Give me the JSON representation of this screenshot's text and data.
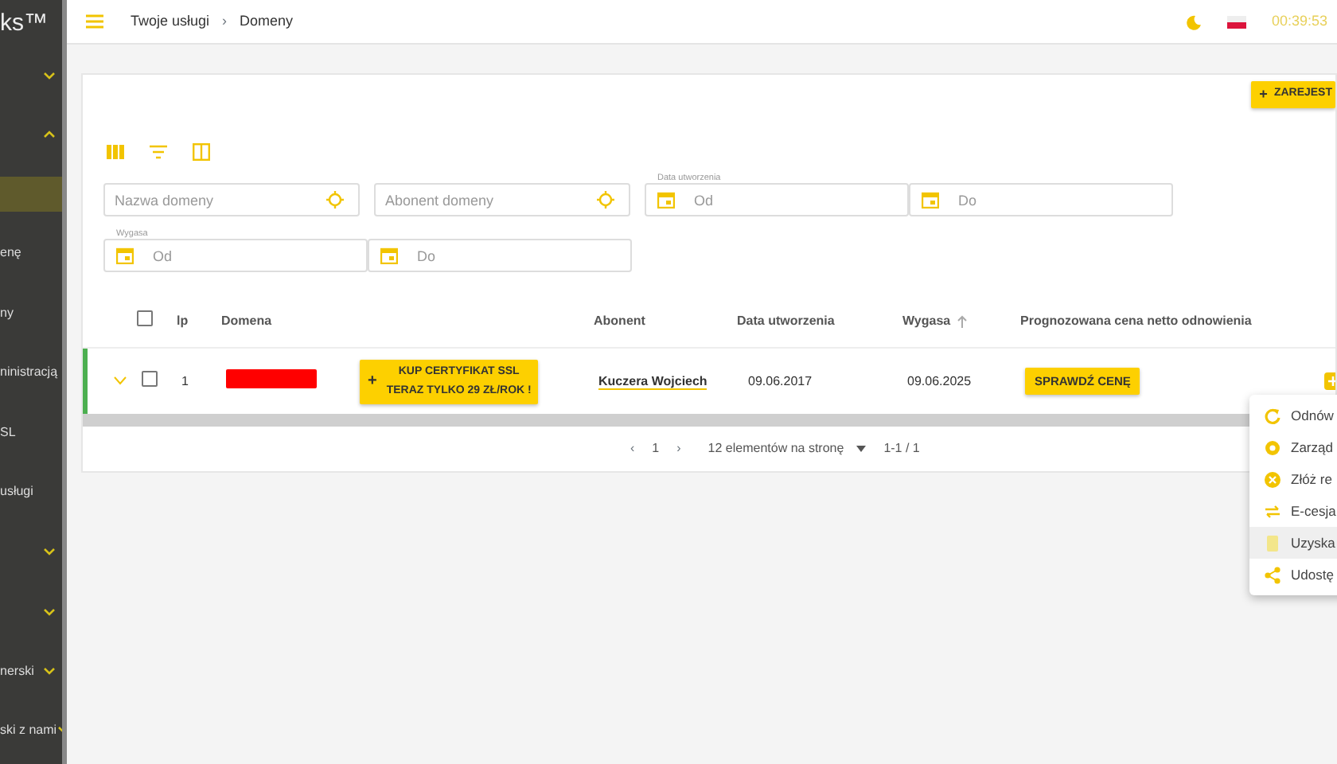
{
  "sidebar": {
    "logo": "ks™",
    "items": [
      {
        "expanded": false,
        "selected": false
      },
      {
        "expanded": true,
        "selected": false
      },
      {
        "selected": true
      },
      {
        "label": "enę",
        "selected": false
      },
      {
        "label": "ny",
        "selected": false
      },
      {
        "label": "ninistracją",
        "selected": false
      },
      {
        "label": "SL",
        "selected": false
      },
      {
        "label": "usługi",
        "selected": false
      },
      {
        "expanded": false,
        "selected": false
      },
      {
        "expanded": false,
        "selected": false
      },
      {
        "label": "nerski",
        "expanded": false,
        "selected": false
      },
      {
        "label": "ski z nami",
        "expanded": false,
        "selected": false
      }
    ]
  },
  "topbar": {
    "breadcrumb": [
      "Twoje usługi",
      "Domeny"
    ],
    "separator": "›",
    "clock": "00:39:53"
  },
  "register_button": {
    "icon": "+",
    "label": "ZAREJEST"
  },
  "filters": [
    {
      "kind": "text",
      "placeholder": "Nazwa domeny"
    },
    {
      "kind": "text",
      "placeholder": "Abonent domeny"
    },
    {
      "kind": "range",
      "label": "Data utworzenia",
      "fields": [
        {
          "placeholder": "Od"
        },
        {
          "placeholder": "Do"
        }
      ]
    },
    {
      "kind": "range",
      "label": "Wygasa",
      "fields": [
        {
          "placeholder": "Od"
        },
        {
          "placeholder": "Do"
        }
      ]
    }
  ],
  "table": {
    "columns": [
      {
        "label": "lp"
      },
      {
        "label": "Domena"
      },
      {
        "label": "Abonent"
      },
      {
        "label": "Data utworzenia"
      },
      {
        "label": "Wygasa",
        "sort_ascending": true
      },
      {
        "label": "Prognozowana cena netto odnowienia"
      }
    ],
    "rows": [
      {
        "expanded": false,
        "checked": false,
        "lp": "1",
        "ssl_button": {
          "icon": "+",
          "lines": [
            "KUP CERTYFIKAT SSL",
            "TERAZ TYLKO 29 ZŁ/ROK !"
          ]
        },
        "abonent": "Kuczera Wojciech",
        "created": "09.06.2017",
        "expires": "09.06.2025",
        "price_button": "SPRAWDŹ CENĘ"
      }
    ],
    "header_checked": false
  },
  "pagination": {
    "prev": "‹",
    "page": "1",
    "next": "›",
    "per_page": "12 elementów na stronę",
    "range": "1-1 / 1"
  },
  "menu": [
    {
      "kind": "refresh",
      "label": "Odnów",
      "selected": false
    },
    {
      "kind": "gear",
      "label": "Zarząd",
      "selected": false
    },
    {
      "kind": "cancel",
      "label": "Złóż re",
      "selected": false
    },
    {
      "kind": "transfer",
      "label": "E-cesja",
      "selected": false
    },
    {
      "kind": "doc",
      "label": "Uzyska",
      "selected": true
    },
    {
      "kind": "share",
      "label": "Udostę",
      "selected": false
    }
  ]
}
